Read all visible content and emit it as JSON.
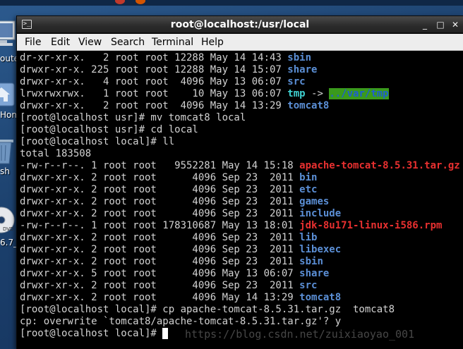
{
  "window": {
    "title": "root@localhost:/usr/local",
    "icon": "terminal-icon",
    "controls": {
      "minimize": "_",
      "maximize": "□",
      "close": "✕"
    }
  },
  "menubar": {
    "items": [
      "File",
      "Edit",
      "View",
      "Search",
      "Terminal",
      "Help"
    ]
  },
  "desktop": {
    "icons": [
      {
        "name": "computer-icon",
        "label": "oute"
      },
      {
        "name": "home-icon",
        "label": "Hom"
      },
      {
        "name": "trash-icon",
        "label": "sh"
      },
      {
        "name": "dvd-icon",
        "label": "6.7_"
      }
    ]
  },
  "colors": {
    "directory": "#5b8fd6",
    "archive": "#e83030",
    "symlink": "#3fd0d0",
    "symlink_target_bg": "#3a9a1c",
    "text": "#d2d2d2",
    "background": "#000000"
  },
  "terminal": {
    "lines": [
      {
        "text": "dr-xr-xr-x.   2 root root 12288 May 14 14:43 ",
        "name": "sbin",
        "kind": "dir"
      },
      {
        "text": "drwxr-xr-x. 225 root root 12288 May 14 15:07 ",
        "name": "share",
        "kind": "dir"
      },
      {
        "text": "drwxr-xr-x.   4 root root  4096 May 13 06:07 ",
        "name": "src",
        "kind": "dir"
      },
      {
        "text": "lrwxrwxrwx.   1 root root    10 May 13 06:07 ",
        "name": "tmp",
        "kind": "link",
        "arrow": " -> ",
        "target": "../var/tmp"
      },
      {
        "text": "drwxr-xr-x.   2 root root  4096 May 14 13:29 ",
        "name": "tomcat8",
        "kind": "dir"
      },
      {
        "text": "[root@localhost usr]# mv tomcat8 local"
      },
      {
        "text": "[root@localhost usr]# cd local"
      },
      {
        "text": "[root@localhost local]# ll"
      },
      {
        "text": "total 183508"
      },
      {
        "text": "-rw-r--r--. 1 root root   9552281 May 14 15:18 ",
        "name": "apache-tomcat-8.5.31.tar.gz",
        "kind": "archive"
      },
      {
        "text": "drwxr-xr-x. 2 root root      4096 Sep 23  2011 ",
        "name": "bin",
        "kind": "dir"
      },
      {
        "text": "drwxr-xr-x. 2 root root      4096 Sep 23  2011 ",
        "name": "etc",
        "kind": "dir"
      },
      {
        "text": "drwxr-xr-x. 2 root root      4096 Sep 23  2011 ",
        "name": "games",
        "kind": "dir"
      },
      {
        "text": "drwxr-xr-x. 2 root root      4096 Sep 23  2011 ",
        "name": "include",
        "kind": "dir"
      },
      {
        "text": "-rw-r--r--. 1 root root 178310687 May 13 18:01 ",
        "name": "jdk-8u171-linux-i586.rpm",
        "kind": "archive"
      },
      {
        "text": "drwxr-xr-x. 2 root root      4096 Sep 23  2011 ",
        "name": "lib",
        "kind": "dir"
      },
      {
        "text": "drwxr-xr-x. 2 root root      4096 Sep 23  2011 ",
        "name": "libexec",
        "kind": "dir"
      },
      {
        "text": "drwxr-xr-x. 2 root root      4096 Sep 23  2011 ",
        "name": "sbin",
        "kind": "dir"
      },
      {
        "text": "drwxr-xr-x. 5 root root      4096 May 13 06:07 ",
        "name": "share",
        "kind": "dir"
      },
      {
        "text": "drwxr-xr-x. 2 root root      4096 Sep 23  2011 ",
        "name": "src",
        "kind": "dir"
      },
      {
        "text": "drwxr-xr-x. 2 root root      4096 May 14 13:29 ",
        "name": "tomcat8",
        "kind": "dir"
      },
      {
        "text": "[root@localhost local]# cp apache-tomcat-8.5.31.tar.gz  tomcat8"
      },
      {
        "text": "cp: overwrite `tomcat8/apache-tomcat-8.5.31.tar.gz'? y"
      },
      {
        "text": "[root@localhost local]# ",
        "cursor": true
      }
    ]
  },
  "watermark": "https://blog.csdn.net/zuixiaoyao_001"
}
